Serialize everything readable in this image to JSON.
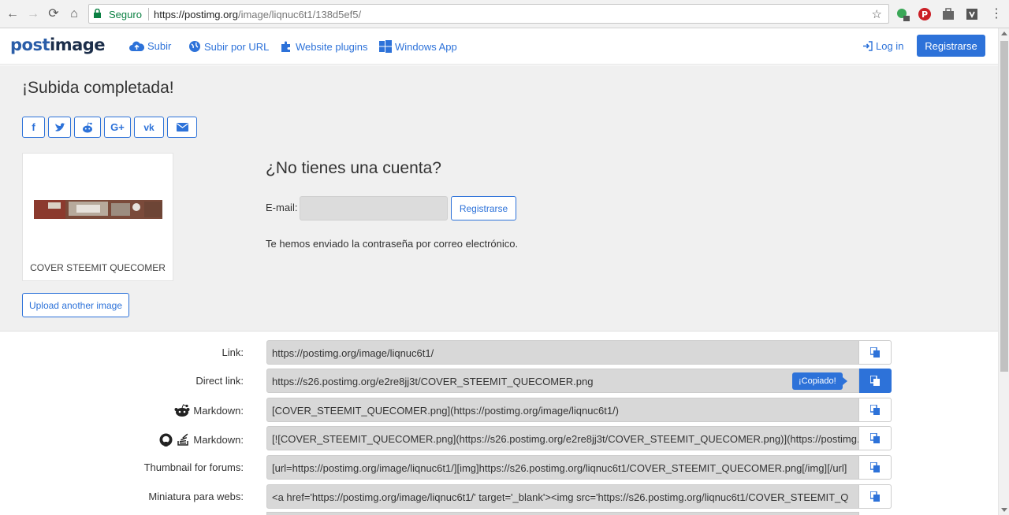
{
  "browser": {
    "secure_label": "Seguro",
    "url_host": "https://postimg.org",
    "url_path": "/image/liqnuc6t1/138d5ef5/"
  },
  "header": {
    "logo_part1": "post",
    "logo_part2": "image",
    "nav": [
      {
        "label": "Subir",
        "icon": "cloud-upload-icon"
      },
      {
        "label": "Subir por URL",
        "icon": "globe-icon"
      },
      {
        "label": "Website plugins",
        "icon": "puzzle-icon"
      },
      {
        "label": "Windows App",
        "icon": "windows-icon"
      }
    ],
    "login_label": "Log in",
    "register_label": "Registrarse"
  },
  "hero": {
    "title": "¡Subida completada!",
    "share": [
      {
        "label": "f",
        "icon": "facebook-icon"
      },
      {
        "label": "t",
        "icon": "twitter-icon"
      },
      {
        "label": "r",
        "icon": "reddit-icon"
      },
      {
        "label": "G+",
        "icon": "google-plus-icon"
      },
      {
        "label": "vk",
        "icon": "vk-icon"
      },
      {
        "label": "✉",
        "icon": "email-icon"
      }
    ],
    "thumb_caption": "COVER STEEMIT QUECOMER",
    "upload_another": "Upload another image",
    "account_title": "¿No tienes una cuenta?",
    "email_label": "E-mail:",
    "email_value": "",
    "register_small": "Registrarse",
    "sent_message": "Te hemos enviado la contraseña por correo electrónico."
  },
  "links": [
    {
      "label": "Link:",
      "value": "https://postimg.org/image/liqnuc6t1/"
    },
    {
      "label": "Direct link:",
      "value": "https://s26.postimg.org/e2re8jj3t/COVER_STEEMIT_QUECOMER.png",
      "tooltip": "¡Copiado!"
    },
    {
      "label": "Markdown:",
      "value": "[COVER_STEEMIT_QUECOMER.png](https://postimg.org/image/liqnuc6t1/)",
      "icon": "reddit-icon"
    },
    {
      "label": "Markdown:",
      "value": "[![COVER_STEEMIT_QUECOMER.png](https://s26.postimg.org/e2re8jj3t/COVER_STEEMIT_QUECOMER.png)](https://postimg.org",
      "icon": "github-icon"
    },
    {
      "label": "Thumbnail for forums:",
      "value": "[url=https://postimg.org/image/liqnuc6t1/][img]https://s26.postimg.org/liqnuc6t1/COVER_STEEMIT_QUECOMER.png[/img][/url]"
    },
    {
      "label": "Miniatura para webs:",
      "value": "<a href='https://postimg.org/image/liqnuc6t1/' target='_blank'><img src='https://s26.postimg.org/liqnuc6t1/COVER_STEEMIT_Q"
    }
  ],
  "colors": {
    "brand_blue": "#2d72d9",
    "field_grey": "#d8d8d8"
  }
}
